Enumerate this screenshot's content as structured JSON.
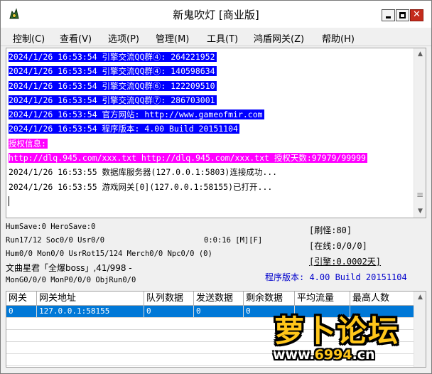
{
  "window": {
    "title": "新鬼吹灯 [商业版]"
  },
  "menu": [
    "控制(C)",
    "查看(V)",
    "选项(P)",
    "管理(M)",
    "工具(T)",
    "鸿盾网关(Z)",
    "帮助(H)"
  ],
  "log": [
    {
      "text": "2024/1/26 16:53:54 引擎交流QQ群④: 264221952",
      "style": "blue"
    },
    {
      "text": "2024/1/26 16:53:54 引擎交流QQ群④: 140598634",
      "style": "blue"
    },
    {
      "text": "2024/1/26 16:53:54 引擎交流QQ群⑥: 122209510",
      "style": "blue"
    },
    {
      "text": "2024/1/26 16:53:54 引擎交流QQ群⑦: 286703001",
      "style": "blue"
    },
    {
      "text": "2024/1/26 16:53:54 官方网站: http://www.gameofmir.com",
      "style": "blue"
    },
    {
      "text": "2024/1/26 16:53:54 程序版本: 4.00 Build 20151104",
      "style": "blue"
    },
    {
      "text": "授权信息:",
      "style": "magenta"
    },
    {
      "text": "http://dlq.945.com/xxx.txt http://dlq.945.com/xxx.txt 授权天数:97979/99999",
      "style": "magenta"
    },
    {
      "text": "2024/1/26 16:53:55 数据库服务器(127.0.0.1:5803)连接成功...",
      "style": "plain"
    },
    {
      "text": "2024/1/26 16:53:55 游戏网关[0](127.0.0.1:58155)已打开...",
      "style": "plain"
    }
  ],
  "status": {
    "save_line": "HumSave:0 HeroSave:0",
    "run_line": "Run17/12 Soc0/0 Usr0/0",
    "uptime": "0:0:16 [M][F]",
    "mon_line": "Hum0/0 Mon0/0 UsrRot15/124 Merch0/0 Npc0/0 (0)",
    "boss_line": "文曲星君「全爆boss」,41/998 -",
    "mong_line": "MonG0/0/0 MonP0/0/0 ObjRun0/0",
    "refresh": "[刷怪:80]",
    "online": "[在线:0/0/0]",
    "engine": "[引擎:0.0002天]",
    "version": "程序版本: 4.00 Build 20151104"
  },
  "gateway_table": {
    "headers": [
      "网关",
      "网关地址",
      "队列数据",
      "发送数据",
      "剩余数据",
      "平均流量",
      "最高人数"
    ],
    "rows": [
      [
        "0",
        "127.0.0.1:58155",
        "0",
        "0",
        "0",
        "",
        ""
      ]
    ]
  },
  "watermark": {
    "logo_text": "萝卜论坛",
    "url_prefix": "www.",
    "url_accent": "6994",
    "url_suffix": ".cn"
  },
  "colors": {
    "log_highlight_blue": "#0000ff",
    "log_highlight_magenta": "#ff00ff",
    "table_selection": "#0078d7",
    "close_button": "#c42b1c",
    "version_text": "#0000cc"
  }
}
